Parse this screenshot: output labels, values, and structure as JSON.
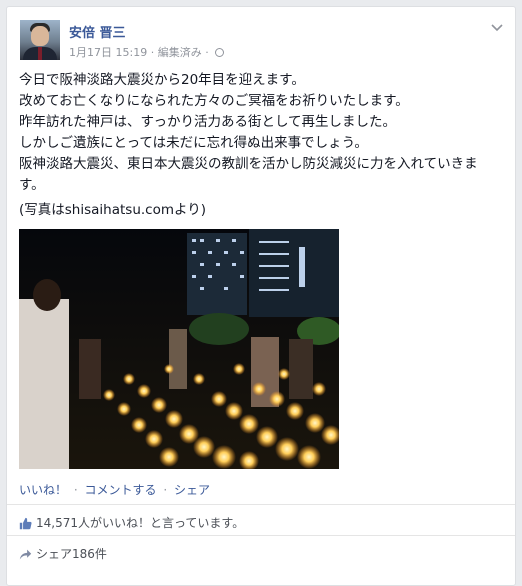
{
  "post": {
    "author": "安倍 晋三",
    "date": "1月17日 15:19",
    "edited": "編集済み",
    "audience_icon": "globe-icon",
    "menu_icon": "chevron-down-icon",
    "text_lines": [
      "今日で阪神淡路大震災から20年目を迎えます。",
      "改めてお亡くなりになられた方々のご冥福をお祈りいたします。",
      "昨年訪れた神戸は、すっかり活力ある街として再生しました。",
      "しかしご遺族にとっては未だに忘れ得ぬ出来事でしょう。",
      "阪神淡路大震災、東日本大震災の教訓を活かし防災減災に力を入れていきま",
      "す。"
    ],
    "credit": "(写真はshisaihatsu.comより)"
  },
  "actions": {
    "like": "いいね！",
    "comment": "コメントする",
    "share": "シェア",
    "separator": "·"
  },
  "stats": {
    "likes_text": "14,571人がいいね！と言っています。",
    "shares_text": "シェア186件",
    "like_icon": "thumbs-up-icon",
    "share_icon": "share-arrow-icon"
  },
  "colors": {
    "link": "#3b5998",
    "muted": "#90949c",
    "text": "#141823"
  }
}
